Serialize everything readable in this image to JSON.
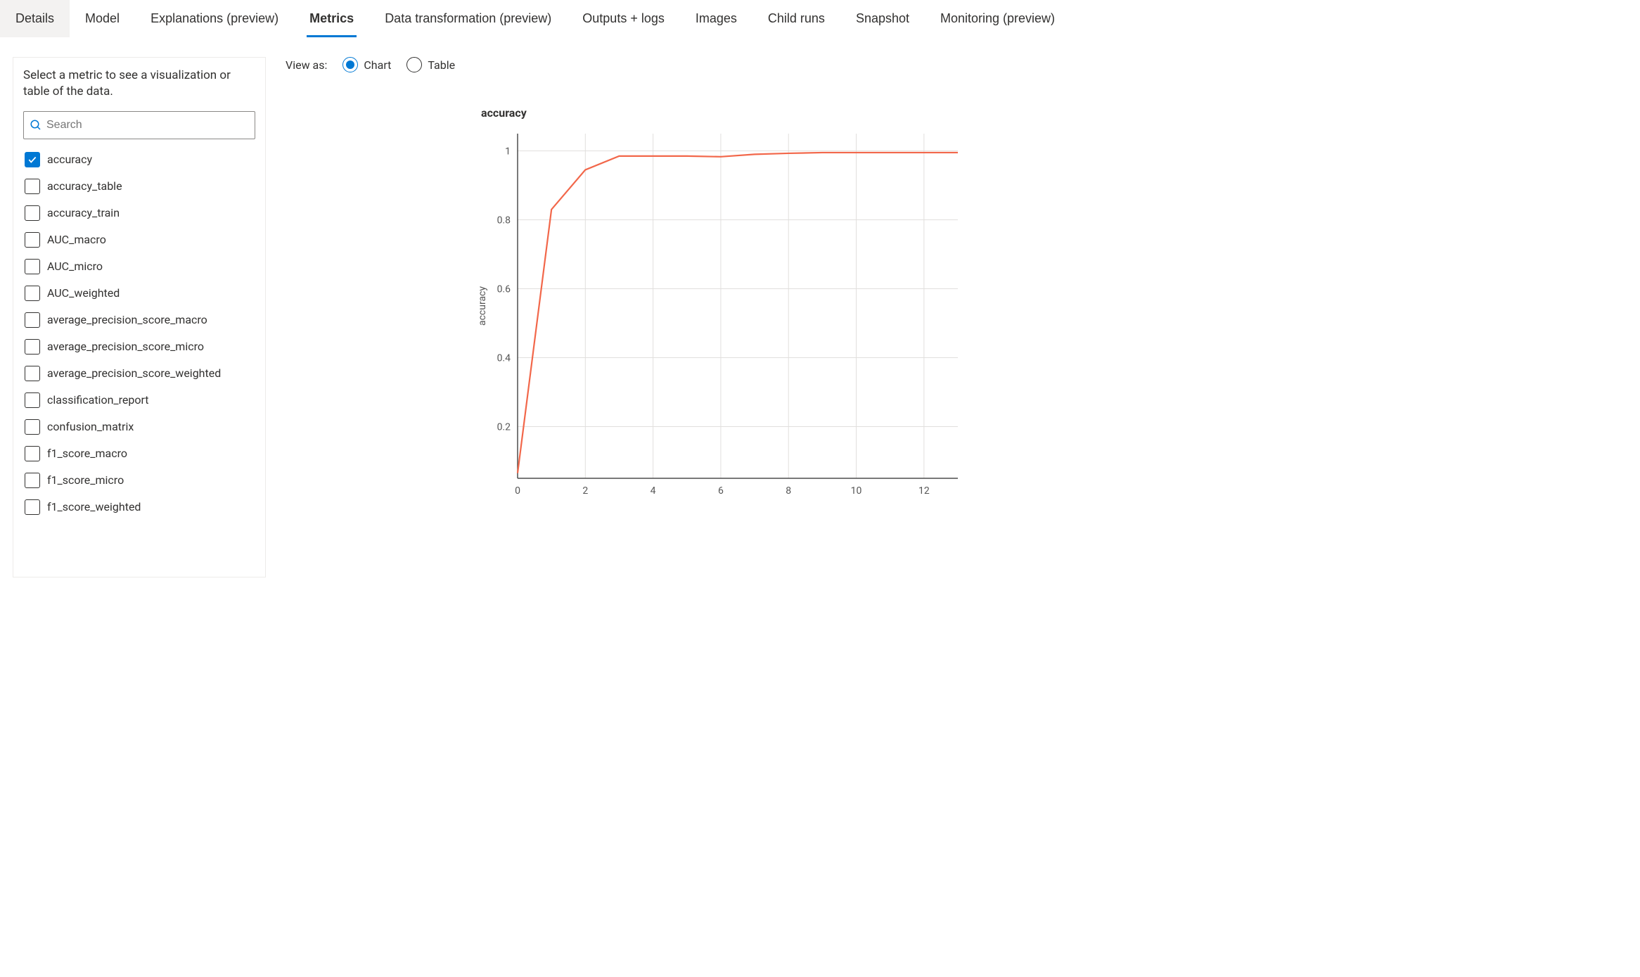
{
  "tabs": [
    {
      "label": "Details",
      "state": "bg"
    },
    {
      "label": "Model",
      "state": ""
    },
    {
      "label": "Explanations (preview)",
      "state": ""
    },
    {
      "label": "Metrics",
      "state": "active"
    },
    {
      "label": "Data transformation (preview)",
      "state": ""
    },
    {
      "label": "Outputs + logs",
      "state": ""
    },
    {
      "label": "Images",
      "state": ""
    },
    {
      "label": "Child runs",
      "state": ""
    },
    {
      "label": "Snapshot",
      "state": ""
    },
    {
      "label": "Monitoring (preview)",
      "state": ""
    }
  ],
  "sidebar": {
    "title": "Select a metric to see a visualization or table of the data.",
    "search_placeholder": "Search",
    "metrics": [
      {
        "label": "accuracy",
        "checked": true
      },
      {
        "label": "accuracy_table",
        "checked": false
      },
      {
        "label": "accuracy_train",
        "checked": false
      },
      {
        "label": "AUC_macro",
        "checked": false
      },
      {
        "label": "AUC_micro",
        "checked": false
      },
      {
        "label": "AUC_weighted",
        "checked": false
      },
      {
        "label": "average_precision_score_macro",
        "checked": false
      },
      {
        "label": "average_precision_score_micro",
        "checked": false
      },
      {
        "label": "average_precision_score_weighted",
        "checked": false
      },
      {
        "label": "classification_report",
        "checked": false
      },
      {
        "label": "confusion_matrix",
        "checked": false
      },
      {
        "label": "f1_score_macro",
        "checked": false
      },
      {
        "label": "f1_score_micro",
        "checked": false
      },
      {
        "label": "f1_score_weighted",
        "checked": false
      }
    ]
  },
  "viewas": {
    "label": "View as:",
    "options": [
      {
        "label": "Chart",
        "selected": true
      },
      {
        "label": "Table",
        "selected": false
      }
    ]
  },
  "chart_data": {
    "type": "line",
    "title": "accuracy",
    "xlabel": "",
    "ylabel": "accuracy",
    "xlim": [
      0,
      13
    ],
    "ylim": [
      0.05,
      1.05
    ],
    "x_ticks": [
      0,
      2,
      4,
      6,
      8,
      10,
      12
    ],
    "y_ticks": [
      0.2,
      0.4,
      0.6,
      0.8,
      1
    ],
    "series": [
      {
        "name": "accuracy",
        "color": "#f2674a",
        "x": [
          0,
          1,
          2,
          3,
          4,
          5,
          6,
          7,
          8,
          9,
          10,
          11,
          12,
          13
        ],
        "y": [
          0.065,
          0.83,
          0.945,
          0.985,
          0.985,
          0.985,
          0.983,
          0.99,
          0.993,
          0.995,
          0.995,
          0.995,
          0.995,
          0.995
        ]
      }
    ]
  }
}
